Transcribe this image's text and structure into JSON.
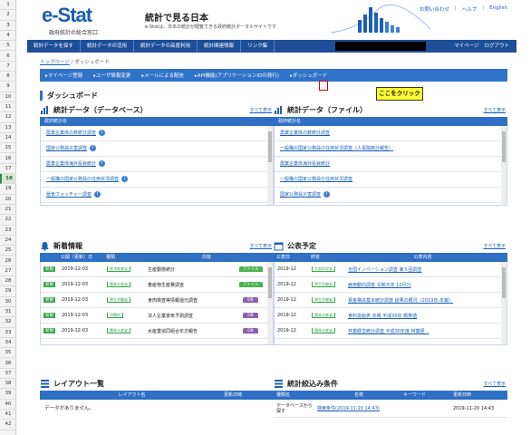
{
  "rows": [
    "1",
    "2",
    "3",
    "4",
    "5",
    "6",
    "7",
    "8",
    "9",
    "10",
    "11",
    "12",
    "13",
    "14",
    "15",
    "16",
    "17",
    "18",
    "19",
    "20",
    "21",
    "22",
    "23",
    "24",
    "25",
    "26",
    "27",
    "28",
    "29",
    "30",
    "31",
    "32",
    "33",
    "34",
    "35",
    "36",
    "37",
    "38",
    "39",
    "40",
    "41",
    "42"
  ],
  "selected_row": "18",
  "header": {
    "logo": "e-Stat",
    "logo_sub": "政府統計の総合窓口",
    "title": "統計で見る日本",
    "desc": "e-Statは、日本の統計が閲覧できる政府統計ポータルサイトです",
    "links": [
      "お問い合わせ",
      "ヘルプ",
      "English"
    ]
  },
  "navbar": {
    "items": [
      "統計データを探す",
      "統計データの活用",
      "統計データの高度利用",
      "統計関連情報",
      "リンク集"
    ],
    "mypage": "マイページ",
    "logout": "ログアウト"
  },
  "breadcrumb": {
    "home": "トップページ",
    "sep": "/",
    "current": "ダッシュボード"
  },
  "subnav": [
    "マイページ登録",
    "ユーザ情報変更",
    "メールによる配信",
    "API機能(アプリケーションIDの発行)",
    "ダッシュボード"
  ],
  "callout": "ここをクリック",
  "page_title": "ダッシュボード",
  "panels": {
    "db": {
      "title": "統計データ（データベース）",
      "more": "すべて表示",
      "col": "政府統計名",
      "items": [
        "農業企業体の数統計調査",
        "国家公務員災害調査",
        "農業企業体海外投資統計",
        "一般職の国家公務員の任用状況調査",
        "景気ウォッチャー調査"
      ]
    },
    "file": {
      "title": "統計データ（ファイル）",
      "more": "すべて表示",
      "col": "政府統計名",
      "items": [
        "農業企業体の数統計調査",
        "一般職の国家公務員の任用状況調査（人事院統計報告）",
        "農業企業体海外投資統計",
        "一般職の国家公務員の任用状況調査",
        "国家公務員災害調査"
      ]
    },
    "news": {
      "title": "新着情報",
      "more": "すべて表示",
      "cols": [
        "公開（更新）日",
        "種類",
        "内容"
      ],
      "rows": [
        {
          "date": "2019-12-03",
          "cat": "経済産業省",
          "name": "生産動態統計",
          "btn": "ファイル"
        },
        {
          "date": "2019-12-03",
          "cat": "農林水産省",
          "name": "畜産物生産費調査",
          "btn": "ファイル"
        },
        {
          "date": "2019-12-03",
          "cat": "厚生労働省",
          "name": "食肉検査等情報還元調査",
          "btn": "DB"
        },
        {
          "date": "2019-12-03",
          "cat": "内閣府",
          "name": "法人企業景気予測調査",
          "btn": "DB"
        },
        {
          "date": "2019-12-03",
          "cat": "農林水産省",
          "name": "水産業協同組合年次報告",
          "btn": "DB"
        }
      ],
      "new_label": "新規"
    },
    "schedule": {
      "title": "公表予定",
      "more": "すべて表示",
      "cols": [
        "公表日",
        "府省",
        "公表内容"
      ],
      "rows": [
        {
          "date": "2019-12",
          "cat": "文部科学省",
          "text": "全国イノベーション調査 第５回調査"
        },
        {
          "date": "2019-12",
          "cat": "厚生労働省",
          "text": "雇用動向調査 令和元年 10月分"
        },
        {
          "date": "2019-12",
          "cat": "厚生労働省",
          "text": "賃金構造基本統計調査 結果の概況（2019年-年報）"
        },
        {
          "date": "2019-12",
          "cat": "農林水産省",
          "text": "食料需給表 年報 平成30年 概算値"
        },
        {
          "date": "2019-12",
          "cat": "農林水産省",
          "text": "林業経営統計調査 平成30年度 林業経…"
        }
      ]
    },
    "layout": {
      "title": "レイアウト一覧",
      "cols": [
        "レイアウト名",
        "更新日時"
      ],
      "empty": "データがありません。"
    },
    "filter": {
      "title": "統計絞込み条件",
      "more": "すべて表示",
      "cols": [
        "種類名",
        "名称",
        "キーワード",
        "更新日時"
      ],
      "row": {
        "type": "データベースから探す",
        "name": "検索条件(2019-11-20 14:43)",
        "kw": "",
        "date": "2019-11-20 14:43"
      }
    }
  }
}
